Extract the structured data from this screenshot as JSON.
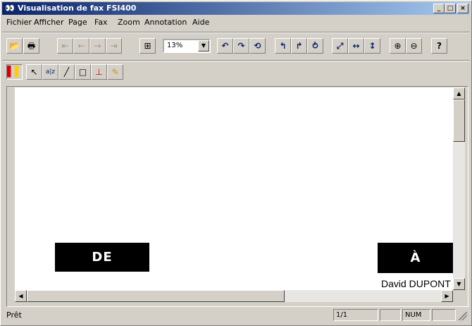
{
  "window": {
    "title": "Visualisation de fax FSI400",
    "icon": "fax-viewer-icon"
  },
  "title_buttons": {
    "minimize": "_",
    "maximize": "□",
    "close": "×"
  },
  "menu": [
    {
      "label": "Fichier"
    },
    {
      "label": "Afficher"
    },
    {
      "label": "Page"
    },
    {
      "label": "Fax"
    },
    {
      "label": "Zoom"
    },
    {
      "label": "Annotation"
    },
    {
      "label": "Aide"
    }
  ],
  "toolbar": {
    "zoom_value": "13%",
    "icons": {
      "open": "📂",
      "print": "🖶",
      "first": "⇤",
      "prev": "←",
      "next": "→",
      "last": "⇥",
      "grid": "⊞",
      "dropdown": "▼",
      "rot_left": "↶",
      "rot_right": "↷",
      "rot_180": "⟲",
      "rot_left2": "↰",
      "rot_right2": "↱",
      "rot_1802": "⥁",
      "fit_page": "⤢",
      "fit_width": "↔",
      "fit_height": "↕",
      "zoom_in": "⊕",
      "zoom_out": "⊖",
      "help": "?"
    }
  },
  "annotation_toolbar": {
    "icons": {
      "color": "▌",
      "select": "↖",
      "text": "a|z",
      "line": "╱",
      "rectangle": "□",
      "stamp": "⊥",
      "highlighter": "✎"
    }
  },
  "document": {
    "from_label": "DE",
    "to_label": "À",
    "recipient": "David DUPONT"
  },
  "scrollbar_icons": {
    "up": "▲",
    "down": "▼",
    "left": "◀",
    "right": "▶"
  },
  "status": {
    "text": "Prêt",
    "page": "1/1",
    "num": "NUM"
  },
  "colors": {
    "titlebar_start": "#0a246a",
    "titlebar_end": "#a6caf0",
    "chrome": "#d4d0c8"
  }
}
